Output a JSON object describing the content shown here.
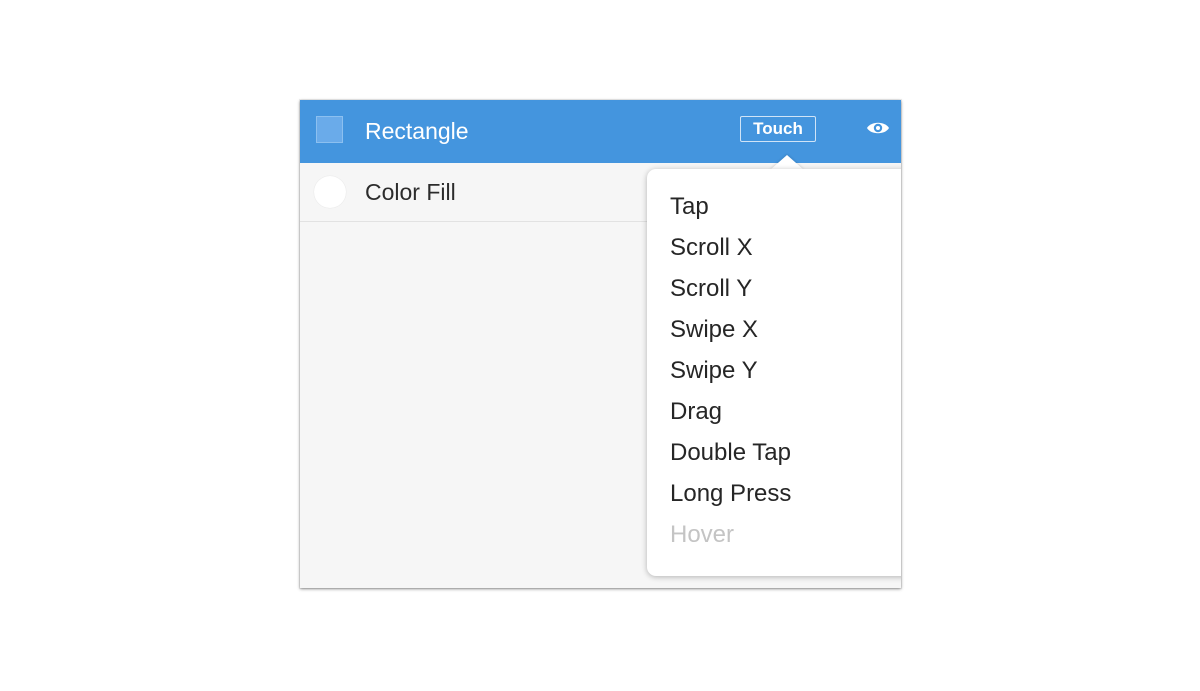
{
  "layers": {
    "selected": {
      "name": "Rectangle",
      "icon": "rectangle-icon",
      "badge": "Touch",
      "visibility_icon": "eye-icon"
    },
    "child": {
      "name": "Color Fill",
      "icon": "color-swatch-icon"
    }
  },
  "touch_menu": {
    "items": [
      {
        "label": "Tap",
        "enabled": true
      },
      {
        "label": "Scroll X",
        "enabled": true
      },
      {
        "label": "Scroll Y",
        "enabled": true
      },
      {
        "label": "Swipe X",
        "enabled": true
      },
      {
        "label": "Swipe Y",
        "enabled": true
      },
      {
        "label": "Drag",
        "enabled": true
      },
      {
        "label": "Double Tap",
        "enabled": true
      },
      {
        "label": "Long Press",
        "enabled": true
      },
      {
        "label": "Hover",
        "enabled": false
      }
    ]
  },
  "colors": {
    "selection": "#4495de",
    "panel_background": "#f6f6f6",
    "menu_text": "#262626",
    "disabled_text": "#c4c4c4"
  }
}
